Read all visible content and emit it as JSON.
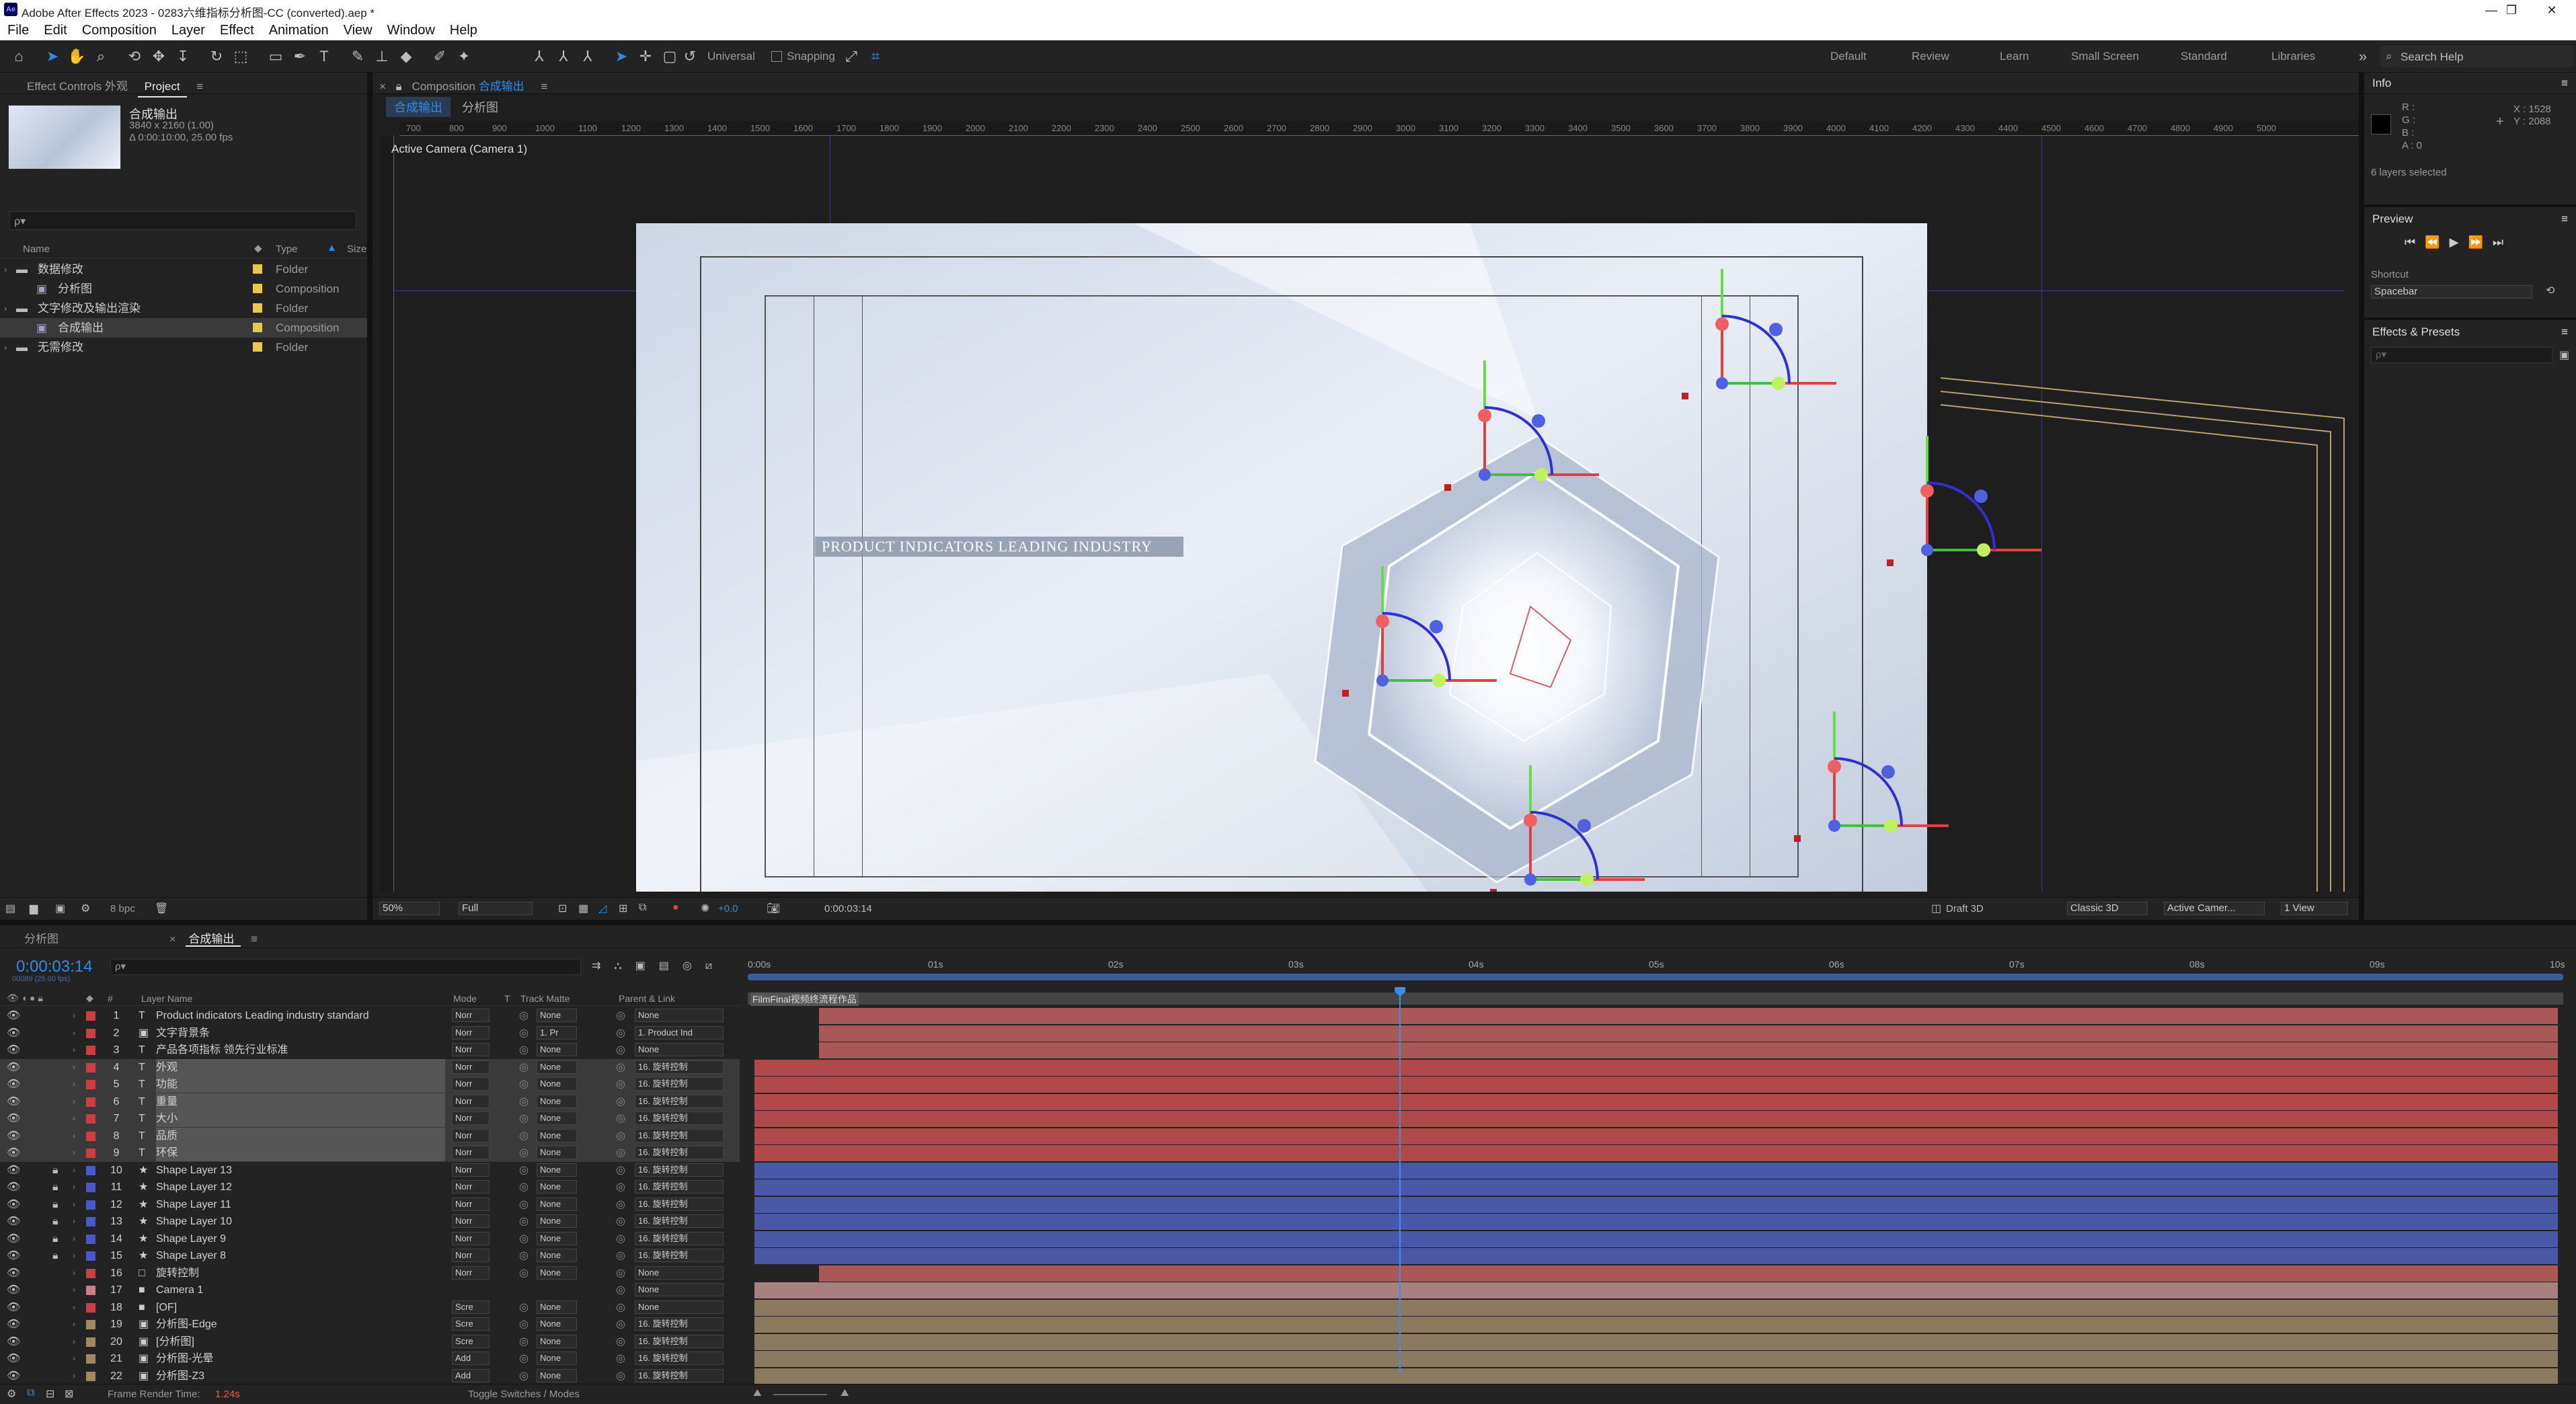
{
  "window": {
    "title": "Adobe After Effects 2023 - 0283六维指标分析图-CC (converted).aep *",
    "logo_text": "Ae",
    "minimize": "—",
    "maximize": "❐",
    "close": "✕"
  },
  "menu": [
    "File",
    "Edit",
    "Composition",
    "Layer",
    "Effect",
    "Animation",
    "View",
    "Window",
    "Help"
  ],
  "toolbar": {
    "universal_label": "Universal",
    "snapping_label": "Snapping",
    "workspaces": [
      "Default",
      "Review",
      "Learn",
      "Small Screen",
      "Standard",
      "Libraries"
    ],
    "search_placeholder": "Search Help"
  },
  "project_panel": {
    "tabs": [
      "Effect Controls 外观",
      "Project"
    ],
    "comp_name": "合成输出",
    "comp_info_1": "3840 x 2160 (1.00)",
    "comp_info_2": "Δ 0:00:10:00, 25.00 fps",
    "search_placeholder": "ρ▾",
    "columns": {
      "name": "Name",
      "type": "Type",
      "size": "Size"
    },
    "items": [
      {
        "name": "数据修改",
        "type": "Folder",
        "color": "#e6c84a"
      },
      {
        "name": "分析图",
        "type": "Composition",
        "color": "#e6c84a"
      },
      {
        "name": "文字修改及输出渲染",
        "type": "Folder",
        "color": "#e6c84a"
      },
      {
        "name": "合成输出",
        "type": "Composition",
        "color": "#e6c84a"
      },
      {
        "name": "无需修改",
        "type": "Folder",
        "color": "#e6c84a"
      }
    ],
    "bpc": "8 bpc"
  },
  "composition_panel": {
    "header_prefix": "Composition",
    "header_name": "合成输出",
    "tabs": [
      "合成输出",
      "分析图"
    ],
    "active_camera": "Active Camera (Camera 1)",
    "ruler_ticks": [
      "700",
      "800",
      "900",
      "1000",
      "1100",
      "1200",
      "1300",
      "1400",
      "1500",
      "1600",
      "1700",
      "1800",
      "1900",
      "2000",
      "2100",
      "2200",
      "2300",
      "2400",
      "2500",
      "2600",
      "2700",
      "2800",
      "2900",
      "3000",
      "3100",
      "3200",
      "3300",
      "3400",
      "3500",
      "3600",
      "3700",
      "3800",
      "3900",
      "4000",
      "4100",
      "4200",
      "4300",
      "4400",
      "4500",
      "4600",
      "4700",
      "4800",
      "4900",
      "5000"
    ],
    "text_label": "PRODUCT INDICATORS LEADING INDUSTRY",
    "footer": {
      "zoom": "50%",
      "resolution": "Full",
      "exposure": "+0.0",
      "timecode": "0:00:03:14",
      "renderer_label": "Draft 3D",
      "renderer": "Classic 3D",
      "camera": "Active Camer...",
      "views": "1 View"
    }
  },
  "info_panel": {
    "title": "Info",
    "r": "R :",
    "g": "G :",
    "b": "B :",
    "a": "A :  0",
    "x": "X : 1528",
    "y": "Y : 2088",
    "layers_selected": "6 layers selected"
  },
  "preview_panel": {
    "title": "Preview",
    "shortcut_label": "Shortcut",
    "shortcut_value": "Spacebar"
  },
  "effects_panel": {
    "title": "Effects & Presets",
    "search_placeholder": "ρ▾"
  },
  "timeline": {
    "tabs": [
      "分析图",
      "合成输出"
    ],
    "timecode": "0:00:03:14",
    "frames": "00089 (25.00 fps)",
    "search_placeholder": "ρ▾",
    "columns": {
      "num": "#",
      "layer_name": "Layer Name",
      "mode": "Mode",
      "t": "T",
      "track_matte": "Track Matte",
      "parent": "Parent & Link"
    },
    "ruler": [
      "0:00s",
      "01s",
      "02s",
      "03s",
      "04s",
      "05s",
      "06s",
      "07s",
      "08s",
      "09s",
      "10s"
    ],
    "marker_label": "FilmFinal视频终流程作品",
    "playhead_fraction": 0.359,
    "layers": [
      {
        "num": "1",
        "icon": "T",
        "name": "Product indicators Leading industry standard",
        "mode": "Norr",
        "matte": "None",
        "parent": "None",
        "color": "#c94040",
        "bar": "lr",
        "sel": false
      },
      {
        "num": "2",
        "icon": "▣",
        "name": "文字背景条",
        "mode": "Norr",
        "matte": "1. Pr",
        "parent": "1. Product Ind",
        "color": "#c94040",
        "bar": "lr",
        "sel": false
      },
      {
        "num": "3",
        "icon": "T",
        "name": "产品各项指标  领先行业标准",
        "mode": "Norr",
        "matte": "None",
        "parent": "None",
        "color": "#c94040",
        "bar": "lr",
        "sel": false
      },
      {
        "num": "4",
        "icon": "T",
        "name": "外观",
        "mode": "Norr",
        "matte": "None",
        "parent": "16. 旋转控制",
        "color": "#c94040",
        "bar": "red",
        "sel": true
      },
      {
        "num": "5",
        "icon": "T",
        "name": "功能",
        "mode": "Norr",
        "matte": "None",
        "parent": "16. 旋转控制",
        "color": "#c94040",
        "bar": "red",
        "sel": true
      },
      {
        "num": "6",
        "icon": "T",
        "name": "重量",
        "mode": "Norr",
        "matte": "None",
        "parent": "16. 旋转控制",
        "color": "#c94040",
        "bar": "red",
        "sel": true
      },
      {
        "num": "7",
        "icon": "T",
        "name": "大小",
        "mode": "Norr",
        "matte": "None",
        "parent": "16. 旋转控制",
        "color": "#c94040",
        "bar": "red",
        "sel": true
      },
      {
        "num": "8",
        "icon": "T",
        "name": "品质",
        "mode": "Norr",
        "matte": "None",
        "parent": "16. 旋转控制",
        "color": "#c94040",
        "bar": "red",
        "sel": true
      },
      {
        "num": "9",
        "icon": "T",
        "name": "环保",
        "mode": "Norr",
        "matte": "None",
        "parent": "16. 旋转控制",
        "color": "#c94040",
        "bar": "red",
        "sel": true
      },
      {
        "num": "10",
        "icon": "★",
        "name": "Shape Layer 13",
        "mode": "Norr",
        "matte": "None",
        "parent": "16. 旋转控制",
        "color": "#4a58c8",
        "bar": "blue",
        "sel": false
      },
      {
        "num": "11",
        "icon": "★",
        "name": "Shape Layer 12",
        "mode": "Norr",
        "matte": "None",
        "parent": "16. 旋转控制",
        "color": "#4a58c8",
        "bar": "blue",
        "sel": false
      },
      {
        "num": "12",
        "icon": "★",
        "name": "Shape Layer 11",
        "mode": "Norr",
        "matte": "None",
        "parent": "16. 旋转控制",
        "color": "#4a58c8",
        "bar": "blue",
        "sel": false
      },
      {
        "num": "13",
        "icon": "★",
        "name": "Shape Layer 10",
        "mode": "Norr",
        "matte": "None",
        "parent": "16. 旋转控制",
        "color": "#4a58c8",
        "bar": "blue",
        "sel": false
      },
      {
        "num": "14",
        "icon": "★",
        "name": "Shape Layer 9",
        "mode": "Norr",
        "matte": "None",
        "parent": "16. 旋转控制",
        "color": "#4a58c8",
        "bar": "blue",
        "sel": false
      },
      {
        "num": "15",
        "icon": "★",
        "name": "Shape Layer 8",
        "mode": "Norr",
        "matte": "None",
        "parent": "16. 旋转控制",
        "color": "#4a58c8",
        "bar": "blue",
        "sel": false
      },
      {
        "num": "16",
        "icon": "□",
        "name": "旋转控制",
        "mode": "Norr",
        "matte": "None",
        "parent": "None",
        "color": "#c94040",
        "bar": "lr",
        "sel": false
      },
      {
        "num": "17",
        "icon": "■",
        "name": "Camera 1",
        "mode": "",
        "matte": "",
        "parent": "None",
        "color": "#c98080",
        "bar": "pink",
        "sel": false
      },
      {
        "num": "18",
        "icon": "■",
        "name": "[OF]",
        "mode": "Scre",
        "matte": "None",
        "parent": "None",
        "color": "#c94040",
        "bar": "tan",
        "sel": false
      },
      {
        "num": "19",
        "icon": "▣",
        "name": "分析图-Edge",
        "mode": "Scre",
        "matte": "None",
        "parent": "16. 旋转控制",
        "color": "#a08860",
        "bar": "tan",
        "sel": false
      },
      {
        "num": "20",
        "icon": "▣",
        "name": "[分析图]",
        "mode": "Scre",
        "matte": "None",
        "parent": "16. 旋转控制",
        "color": "#a08860",
        "bar": "tan",
        "sel": false
      },
      {
        "num": "21",
        "icon": "▣",
        "name": "分析图-光晕",
        "mode": "Add",
        "matte": "None",
        "parent": "16. 旋转控制",
        "color": "#a08860",
        "bar": "tan",
        "sel": false
      },
      {
        "num": "22",
        "icon": "▣",
        "name": "分析图-Z3",
        "mode": "Add",
        "matte": "None",
        "parent": "16. 旋转控制",
        "color": "#a08860",
        "bar": "tan",
        "sel": false
      }
    ],
    "footer": {
      "render_label": "Frame Render Time:",
      "render_time": "1.24s",
      "toggle": "Toggle Switches / Modes"
    }
  }
}
